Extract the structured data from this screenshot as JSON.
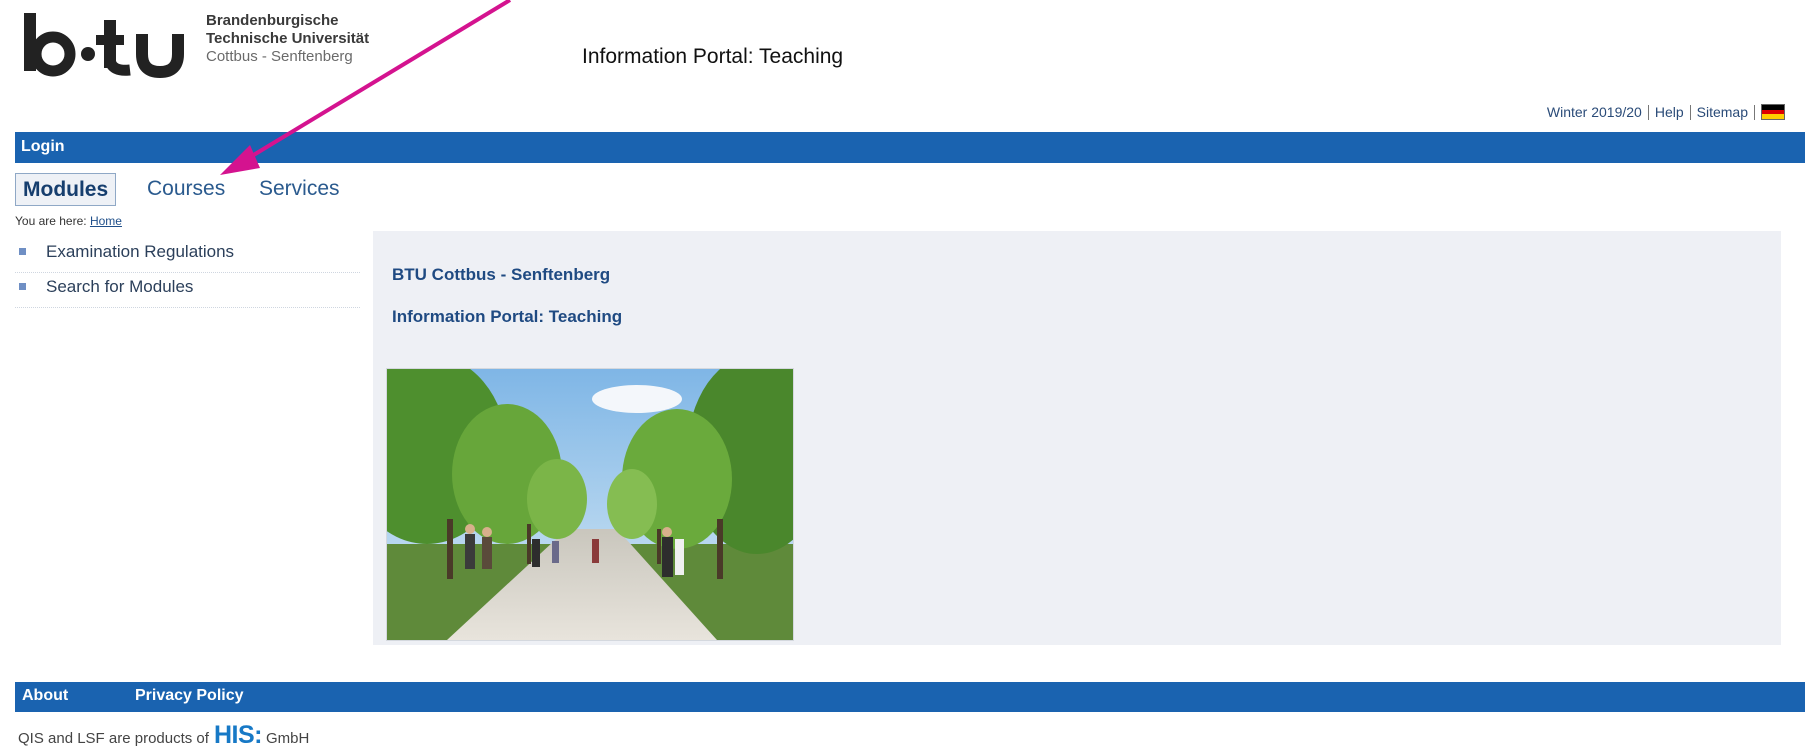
{
  "header": {
    "logo_mark": "b-tu",
    "logo_line1": "Brandenburgische",
    "logo_line2": "Technische Universität",
    "logo_line3": "Cottbus - Senftenberg",
    "portal_title": "Information Portal: Teaching"
  },
  "top_links": {
    "semester": "Winter 2019/20",
    "help": "Help",
    "sitemap": "Sitemap",
    "language_flag": "german-flag-icon"
  },
  "login_bar": {
    "login_label": "Login"
  },
  "tabs": [
    {
      "label": "Modules",
      "active": true
    },
    {
      "label": "Courses",
      "active": false
    },
    {
      "label": "Services",
      "active": false
    }
  ],
  "breadcrumb": {
    "prefix": "You are here: ",
    "home": "Home"
  },
  "sidebar": {
    "items": [
      {
        "label": "Examination Regulations"
      },
      {
        "label": "Search for Modules"
      }
    ]
  },
  "main": {
    "heading1": "BTU Cottbus - Senftenberg",
    "heading2": "Information Portal: Teaching"
  },
  "footer": {
    "about": "About",
    "privacy": "Privacy Policy",
    "credit_prefix": "QIS and LSF are products of",
    "credit_brand": "HIS",
    "credit_suffix": "GmbH"
  },
  "colors": {
    "accent_blue": "#1a63b0",
    "annotation_arrow": "#d4138f",
    "panel_bg": "#eef0f5"
  }
}
